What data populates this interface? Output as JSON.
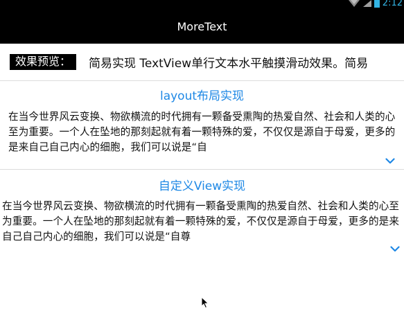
{
  "status_bar": {
    "time": "2:12",
    "icons": [
      "wifi-icon",
      "signal-icon",
      "battery-icon"
    ],
    "accent_color": "#33b5e5"
  },
  "action_bar": {
    "title": "MoreText"
  },
  "preview": {
    "label": "效果预览：",
    "marquee_text": "简易实现 TextView单行文本水平触摸滑动效果。简易"
  },
  "sections": [
    {
      "title": "layout布局实现",
      "text": "在当今世界风云变换、物欲横流的时代拥有一颗备受熏陶的热爱自然、社会和人类的心至为重要。一个人在坠地的那刻起就有着一颗特殊的爱，不仅仅是源自于母爱，更多的是来自己自己内心的细胞，我们可以说是“自",
      "expand_icon": "chevron-down-icon"
    },
    {
      "title": "自定义View实现",
      "text": "在当今世界风云变换、物欲横流的时代拥有一颗备受熏陶的热爱自然、社会和人类的心至为重要。一个人在坠地的那刻起就有着一颗特殊的爱，不仅仅是源自于母爱，更多的是来自己自己内心的细胞，我们可以说是“自尊",
      "expand_icon": "chevron-down-icon"
    }
  ],
  "colors": {
    "title_blue": "#1e88e5",
    "bar_black": "#000000",
    "divider": "#dcdcdc"
  }
}
